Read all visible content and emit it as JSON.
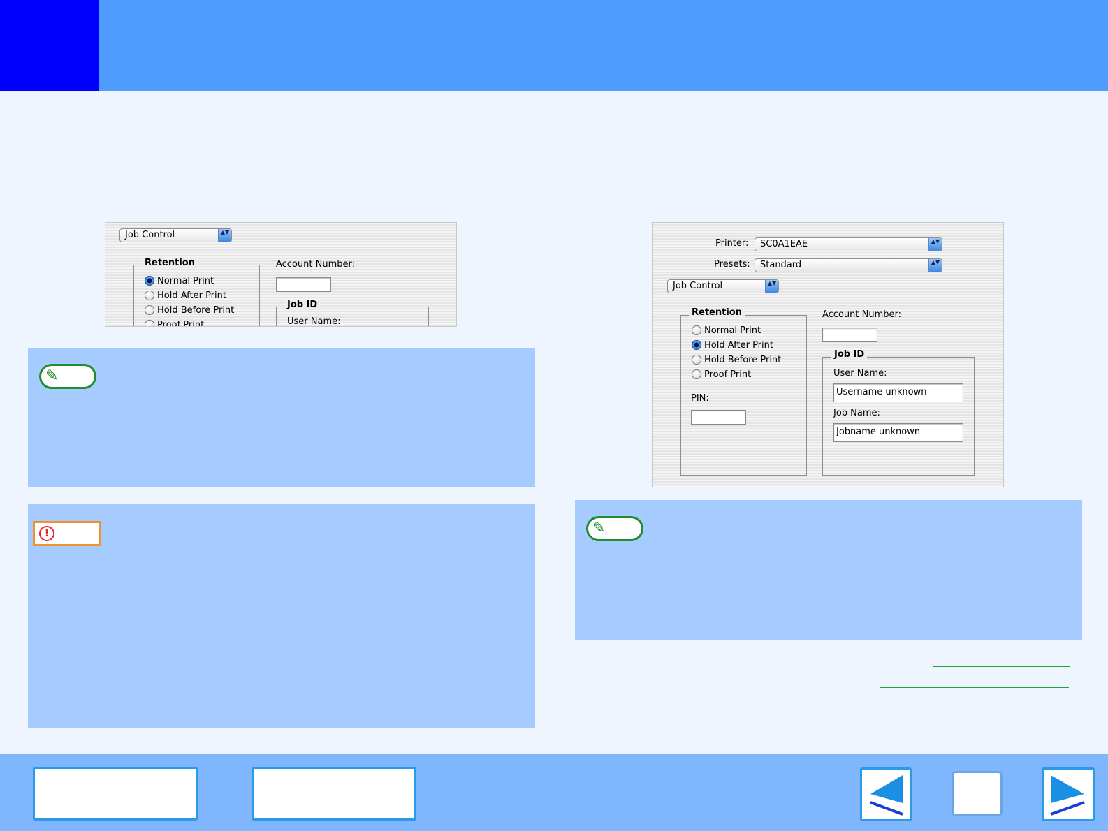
{
  "colors": {
    "header": "#509bfe",
    "header_badge": "#0000fe",
    "page_background": "#eef5fe",
    "note_box": "#a6cbfe",
    "footer": "#80b6fe",
    "note_icon_border": "#1f8c2e",
    "warning_icon_border": "#f2922a",
    "warning_glyph": "#e4262b",
    "link_underline": "#1fa334",
    "nav_arrow": "#1a8fe3"
  },
  "left_panel": {
    "popup": "Job Control",
    "retention_title": "Retention",
    "options": [
      "Normal Print",
      "Hold After Print",
      "Hold Before Print",
      "Proof Print"
    ],
    "selected_option": "Normal Print",
    "account_number_label": "Account Number:",
    "job_id_title": "Job ID",
    "user_name_label": "User Name:"
  },
  "right_panel": {
    "printer_label": "Printer:",
    "printer_value": "SC0A1EAE",
    "presets_label": "Presets:",
    "presets_value": "Standard",
    "popup": "Job Control",
    "retention_title": "Retention",
    "options": [
      "Normal Print",
      "Hold After Print",
      "Hold Before Print",
      "Proof Print"
    ],
    "selected_option": "Hold After Print",
    "pin_label": "PIN:",
    "account_number_label": "Account Number:",
    "job_id_title": "Job ID",
    "user_name_label": "User Name:",
    "user_name_value": "Username unknown",
    "job_name_label": "Job Name:",
    "job_name_value": "Jobname unknown"
  },
  "icons": {
    "note_left": "pencil-icon",
    "warning": "exclamation-icon",
    "note_right": "pencil-icon",
    "prev": "left-arrow-icon",
    "next": "right-arrow-icon",
    "glyph_pencil": "✎",
    "glyph_exclamation": "!",
    "glyph_up_down": "▲▼"
  }
}
